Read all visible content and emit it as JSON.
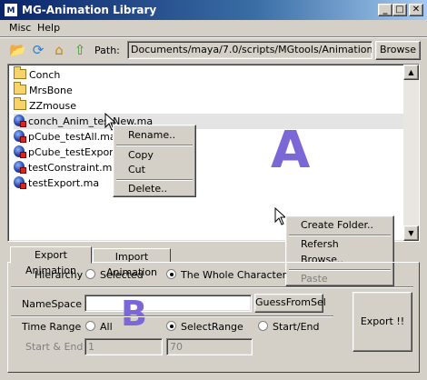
{
  "window": {
    "title": "MG-Animation Library",
    "controls": {
      "minimize": "_",
      "maximize": "□",
      "close": "✕"
    }
  },
  "menu": [
    "Misc",
    "Help"
  ],
  "toolbar": {
    "icons": [
      "open-folder-icon",
      "refresh-icon",
      "home-icon",
      "up-folder-icon"
    ],
    "path_label": "Path:",
    "path_value": "Documents/maya/7.0/scripts/MGtools/Animation_Bank",
    "browse_label": "Browse"
  },
  "filelist": {
    "folders": [
      "Conch",
      "MrsBone",
      "ZZmouse"
    ],
    "files": [
      "conch_Anim_testNew.ma",
      "pCube_testAll.ma",
      "pCube_testExportSel",
      "testConstraint.ma",
      "testExport.ma"
    ]
  },
  "annotations": {
    "a": "A",
    "b": "B"
  },
  "context_menu_file": {
    "rename": "Rename..",
    "copy": "Copy",
    "cut": "Cut",
    "delete": "Delete.."
  },
  "context_menu_folder": {
    "create_folder": "Create Folder..",
    "refresh": "Refersh",
    "browse": "Browse..",
    "paste": "Paste"
  },
  "tabs": [
    "Export Animation",
    "Import Animation"
  ],
  "export": {
    "hierarchy_label": "Hierarchy",
    "hierarchy_selected": "Selected",
    "hierarchy_whole": "The Whole Character",
    "namespace_label": "NameSpace",
    "namespace_value": "",
    "guess_button": "GuessFromSel",
    "time_range_label": "Time Range",
    "time_all": "All",
    "time_select": "SelectRange",
    "time_startend": "Start/End",
    "start_end_label": "Start & End",
    "start_value": "1",
    "end_value": "70",
    "export_button": "Export !!"
  },
  "colors": {
    "annotation": "#7b68d6",
    "titlebar": "#0a246a"
  }
}
